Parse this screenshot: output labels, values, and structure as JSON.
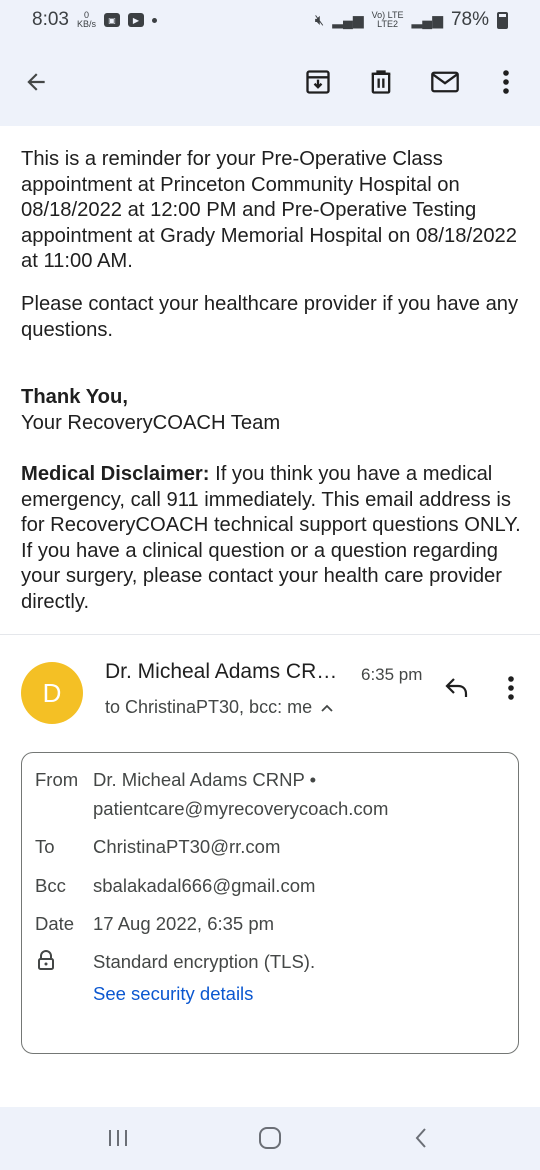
{
  "status_bar": {
    "time": "8:03",
    "speed_value": "0",
    "speed_unit": "KB/s",
    "network_label_top": "Vo) LTE",
    "network_label_bottom": "LTE2",
    "battery": "78%"
  },
  "toolbar": {
    "back_icon": "arrow-left-icon",
    "archive_icon": "archive-icon",
    "delete_icon": "trash-icon",
    "mark_unread_icon": "mail-icon",
    "more_icon": "more-vertical-icon"
  },
  "message": {
    "paragraph_1": "This is a reminder for your Pre-Operative Class appointment at Princeton Community Hospital on 08/18/2022 at 12:00 PM and Pre-Operative Testing appointment at Grady Memorial Hospital on 08/18/2022 at 11:00 AM.",
    "paragraph_2": "Please contact your healthcare provider if you have any questions.",
    "thank_you": "Thank You,",
    "team": "Your RecoveryCOACH Team",
    "disclaimer_label": "Medical Disclaimer:",
    "disclaimer_text": " If you think you have a medical emergency, call 911 immediately. This email address is for RecoveryCOACH technical support questions ONLY. If you have a clinical question or a question regarding your surgery, please contact your health care provider directly."
  },
  "header": {
    "avatar_letter": "D",
    "avatar_color": "#f4c025",
    "sender": "Dr. Micheal Adams CRNP",
    "time": "6:35 pm",
    "to_summary": "to ChristinaPT30, bcc: me"
  },
  "details": {
    "from_label": "From",
    "from_name": "Dr. Micheal Adams CRNP •",
    "from_email": "patientcare@myrecoverycoach.com",
    "to_label": "To",
    "to_value": "ChristinaPT30@rr.com",
    "bcc_label": "Bcc",
    "bcc_value": "sbalakadal666@gmail.com",
    "date_label": "Date",
    "date_value": "17 Aug 2022, 6:35 pm",
    "encryption": "Standard encryption (TLS).",
    "security_link": "See security details"
  },
  "colors": {
    "bar_background": "#eef2fa",
    "link": "#0b57d0"
  }
}
